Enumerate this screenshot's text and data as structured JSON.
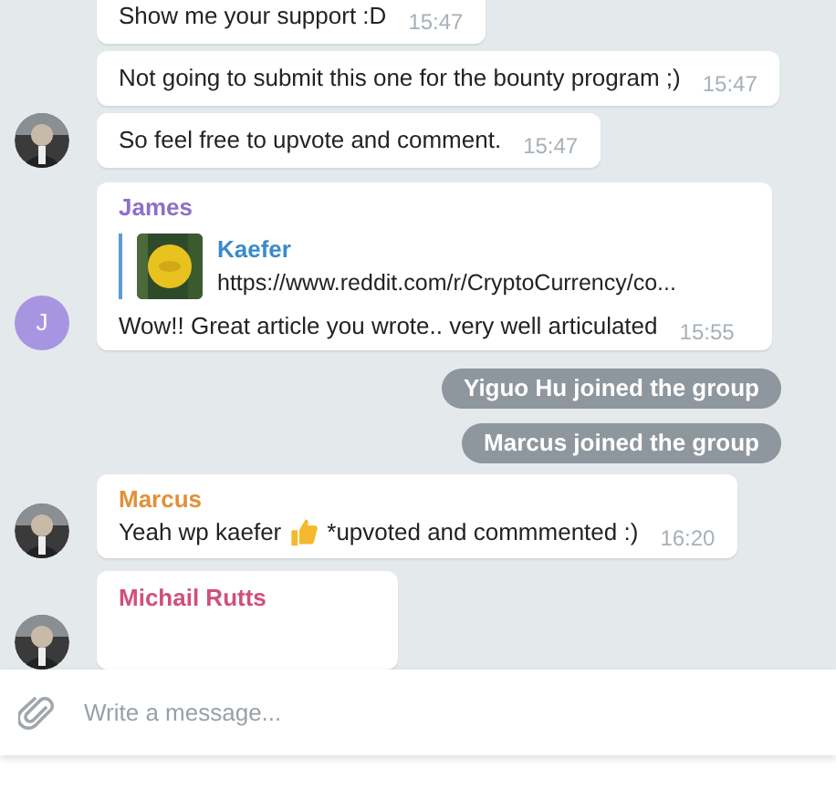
{
  "messages": [
    {
      "kind": "text",
      "text": "Show me your support :D",
      "time": "15:47"
    },
    {
      "kind": "text",
      "text": "Not going to submit this one for the bounty program ;)",
      "time": "15:47"
    },
    {
      "kind": "text",
      "text": "So feel free to upvote and comment.",
      "time": "15:47"
    },
    {
      "kind": "link",
      "sender": "James",
      "color": "#8e6fc8",
      "preview_title": "Kaefer",
      "preview_url": "https://www.reddit.com/r/CryptoCurrency/co...",
      "text": "Wow!! Great article you wrote.. very well articulated",
      "time": "15:55",
      "avatar": {
        "kind": "letter",
        "letter": "J",
        "color": "#a895e2"
      }
    },
    {
      "kind": "service",
      "text": "Yiguo Hu joined the group"
    },
    {
      "kind": "service",
      "text": "Marcus joined the group"
    },
    {
      "kind": "emoji_text",
      "sender": "Marcus",
      "color": "#e0913a",
      "text_before": "Yeah wp kaefer",
      "text_after": "*upvoted and commmented :)",
      "time": "16:20"
    },
    {
      "kind": "cut",
      "sender": "Michail Rutts",
      "color": "#d0507a"
    }
  ],
  "composer": {
    "placeholder": "Write a message..."
  }
}
